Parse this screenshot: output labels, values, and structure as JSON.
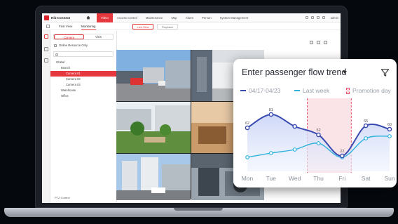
{
  "app": {
    "brand": "Hik-Connect",
    "nav": [
      "Video",
      "Access Control",
      "Maintenance",
      "Map",
      "Alarm",
      "Person",
      "System Management"
    ],
    "active_nav": "Video",
    "user": "admin"
  },
  "tabs": [
    "Fast View",
    "Monitoring"
  ],
  "active_tab": "Monitoring",
  "panel": {
    "segments": [
      "Camera",
      "View"
    ],
    "online_only": "Online Resource Only",
    "tree": [
      {
        "label": "Global",
        "level": 0,
        "selected": false
      },
      {
        "label": "Branch",
        "level": 1,
        "selected": false
      },
      {
        "label": "Camera 01",
        "level": 2,
        "selected": true
      },
      {
        "label": "Camera 02",
        "level": 2,
        "selected": false
      },
      {
        "label": "Camera 03",
        "level": 2,
        "selected": false
      },
      {
        "label": "Warehouse",
        "level": 1,
        "selected": false
      },
      {
        "label": "Office",
        "level": 1,
        "selected": false
      }
    ],
    "ptz": "PTZ Control"
  },
  "view_modes": [
    "Live View",
    "Playback"
  ],
  "active_view_mode": "Live View",
  "card": {
    "title": "Enter passenger flow trend",
    "legend": [
      {
        "label": "04/17-04/23",
        "color": "#3a4bb0"
      },
      {
        "label": "Last week",
        "color": "#2fb2dc"
      },
      {
        "label": "Promotion day",
        "color": "#e6536a"
      }
    ]
  },
  "colors": {
    "accent": "#e5393f",
    "series_current": "#3a4bb0",
    "series_last": "#2fb2dc",
    "promotion": "#e6536a"
  },
  "chart_data": {
    "type": "line",
    "title": "Enter passenger flow trend",
    "categories": [
      "Mon",
      "Tue",
      "Wed",
      "Thu",
      "Fri",
      "Sat",
      "Sun"
    ],
    "series": [
      {
        "name": "04/17-04/23",
        "values": [
          62,
          81,
          64,
          52,
          22,
          65,
          60
        ],
        "labels": [
          "62",
          "81",
          "",
          "52",
          "22",
          "65",
          "60"
        ]
      },
      {
        "name": "Last week",
        "values": [
          20,
          26,
          31,
          40,
          20,
          47,
          50
        ]
      }
    ],
    "highlight": {
      "name": "Promotion day",
      "from": "Thu",
      "to": "Fri"
    },
    "ylim": [
      0,
      100
    ],
    "grid": false
  }
}
